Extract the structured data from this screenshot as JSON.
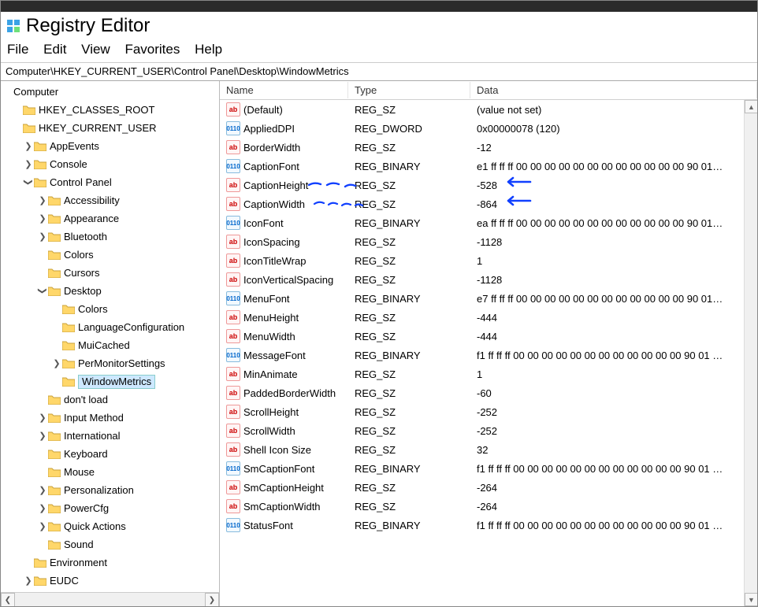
{
  "app": {
    "title": "Registry Editor"
  },
  "menu": {
    "file": "File",
    "edit": "Edit",
    "view": "View",
    "favorites": "Favorites",
    "help": "Help"
  },
  "address": "Computer\\HKEY_CURRENT_USER\\Control Panel\\Desktop\\WindowMetrics",
  "tree": {
    "root": "Computer",
    "hkcr": "HKEY_CLASSES_ROOT",
    "hkcu": "HKEY_CURRENT_USER",
    "appevents": "AppEvents",
    "console": "Console",
    "controlpanel": "Control Panel",
    "accessibility": "Accessibility",
    "appearance": "Appearance",
    "bluetooth": "Bluetooth",
    "colors": "Colors",
    "cursors": "Cursors",
    "desktop": "Desktop",
    "desktop_colors": "Colors",
    "languageconfiguration": "LanguageConfiguration",
    "muicached": "MuiCached",
    "permonitorsettings": "PerMonitorSettings",
    "windowmetrics": "WindowMetrics",
    "dontload": "don't load",
    "inputmethod": "Input Method",
    "international": "International",
    "keyboard": "Keyboard",
    "mouse": "Mouse",
    "personalization": "Personalization",
    "powercfg": "PowerCfg",
    "quickactions": "Quick Actions",
    "sound": "Sound",
    "environment": "Environment",
    "eudc": "EUDC"
  },
  "columns": {
    "name": "Name",
    "type": "Type",
    "data": "Data"
  },
  "values": [
    {
      "icon": "sz",
      "name": "(Default)",
      "type": "REG_SZ",
      "data": "(value not set)"
    },
    {
      "icon": "bin",
      "name": "AppliedDPI",
      "type": "REG_DWORD",
      "data": "0x00000078 (120)"
    },
    {
      "icon": "sz",
      "name": "BorderWidth",
      "type": "REG_SZ",
      "data": "-12"
    },
    {
      "icon": "bin",
      "name": "CaptionFont",
      "type": "REG_BINARY",
      "data": "e1 ff ff ff 00 00 00 00 00 00 00 00 00 00 00 00 90 01…"
    },
    {
      "icon": "sz",
      "name": "CaptionHeight",
      "type": "REG_SZ",
      "data": "-528"
    },
    {
      "icon": "sz",
      "name": "CaptionWidth",
      "type": "REG_SZ",
      "data": "-864"
    },
    {
      "icon": "bin",
      "name": "IconFont",
      "type": "REG_BINARY",
      "data": "ea ff ff ff 00 00 00 00 00 00 00 00 00 00 00 00 90 01…"
    },
    {
      "icon": "sz",
      "name": "IconSpacing",
      "type": "REG_SZ",
      "data": "-1128"
    },
    {
      "icon": "sz",
      "name": "IconTitleWrap",
      "type": "REG_SZ",
      "data": "1"
    },
    {
      "icon": "sz",
      "name": "IconVerticalSpacing",
      "type": "REG_SZ",
      "data": "-1128"
    },
    {
      "icon": "bin",
      "name": "MenuFont",
      "type": "REG_BINARY",
      "data": "e7 ff ff ff 00 00 00 00 00 00 00 00 00 00 00 00 90 01…"
    },
    {
      "icon": "sz",
      "name": "MenuHeight",
      "type": "REG_SZ",
      "data": "-444"
    },
    {
      "icon": "sz",
      "name": "MenuWidth",
      "type": "REG_SZ",
      "data": "-444"
    },
    {
      "icon": "bin",
      "name": "MessageFont",
      "type": "REG_BINARY",
      "data": "f1 ff ff ff 00 00 00 00 00 00 00 00 00 00 00 00 90 01 …"
    },
    {
      "icon": "sz",
      "name": "MinAnimate",
      "type": "REG_SZ",
      "data": "1"
    },
    {
      "icon": "sz",
      "name": "PaddedBorderWidth",
      "type": "REG_SZ",
      "data": "-60"
    },
    {
      "icon": "sz",
      "name": "ScrollHeight",
      "type": "REG_SZ",
      "data": "-252"
    },
    {
      "icon": "sz",
      "name": "ScrollWidth",
      "type": "REG_SZ",
      "data": "-252"
    },
    {
      "icon": "sz",
      "name": "Shell Icon Size",
      "type": "REG_SZ",
      "data": "32"
    },
    {
      "icon": "bin",
      "name": "SmCaptionFont",
      "type": "REG_BINARY",
      "data": "f1 ff ff ff 00 00 00 00 00 00 00 00 00 00 00 00 90 01 …"
    },
    {
      "icon": "sz",
      "name": "SmCaptionHeight",
      "type": "REG_SZ",
      "data": "-264"
    },
    {
      "icon": "sz",
      "name": "SmCaptionWidth",
      "type": "REG_SZ",
      "data": "-264"
    },
    {
      "icon": "bin",
      "name": "StatusFont",
      "type": "REG_BINARY",
      "data": "f1 ff ff ff 00 00 00 00 00 00 00 00 00 00 00 00 90 01 …"
    }
  ],
  "icons": {
    "sz_text": "ab",
    "bin_text": "011\n110"
  }
}
